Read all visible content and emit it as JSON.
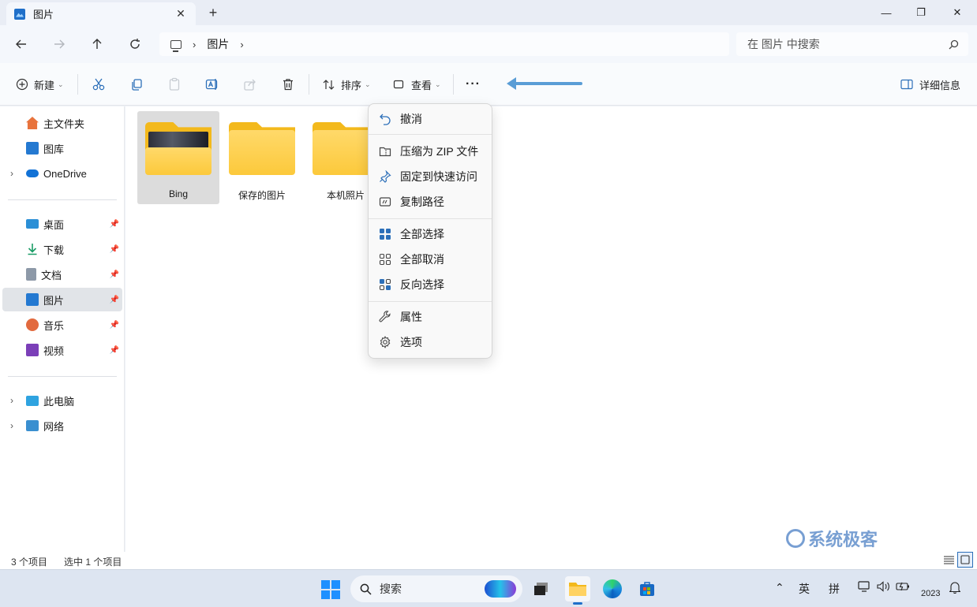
{
  "window": {
    "tab_title": "图片",
    "tab_close": "✕",
    "new_tab": "+",
    "minimize": "—",
    "maximize": "❐",
    "close": "✕"
  },
  "address": {
    "breadcrumb_item": "图片",
    "separator": "›",
    "search_placeholder": "在 图片 中搜索"
  },
  "toolbar": {
    "new_label": "新建",
    "sort_label": "排序",
    "view_label": "查看",
    "more_label": "···",
    "details_label": "详细信息"
  },
  "sidebar": {
    "top": [
      {
        "label": "主文件夹"
      },
      {
        "label": "图库"
      },
      {
        "label": "OneDrive"
      }
    ],
    "quick": [
      {
        "label": "桌面"
      },
      {
        "label": "下载"
      },
      {
        "label": "文档"
      },
      {
        "label": "图片"
      },
      {
        "label": "音乐"
      },
      {
        "label": "视频"
      }
    ],
    "bottom": [
      {
        "label": "此电脑"
      },
      {
        "label": "网络"
      }
    ]
  },
  "files": [
    {
      "name": "Bing"
    },
    {
      "name": "保存的图片"
    },
    {
      "name": "本机照片"
    }
  ],
  "context_menu": {
    "items": [
      {
        "label": "撤消"
      },
      {
        "label": "压缩为 ZIP 文件"
      },
      {
        "label": "固定到快速访问"
      },
      {
        "label": "复制路径"
      },
      {
        "label": "全部选择"
      },
      {
        "label": "全部取消"
      },
      {
        "label": "反向选择"
      },
      {
        "label": "属性"
      },
      {
        "label": "选项"
      }
    ]
  },
  "status": {
    "count": "3 个项目",
    "selected": "选中 1 个项目"
  },
  "watermark": "系统极客",
  "taskbar": {
    "search_label": "搜索",
    "ime_lang": "英",
    "ime_mode": "拼",
    "clock": "2023"
  },
  "colors": {
    "accent": "#1f6fc9",
    "folder": "#fcc93b",
    "arrow": "#5a9dd6",
    "selection": "#dcdcdc"
  }
}
